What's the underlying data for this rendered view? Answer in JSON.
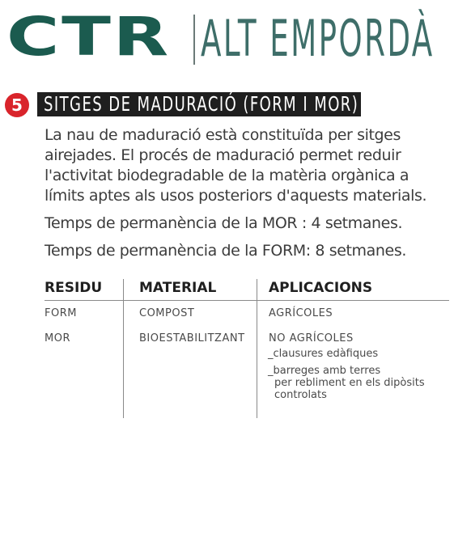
{
  "header": {
    "logo": "CTR",
    "subtitle": "ALT EMPORDÀ"
  },
  "section": {
    "number": "5",
    "title": "SITGES DE MADURACIÓ (FORM I MOR)"
  },
  "body": {
    "paragraph_1": "La nau de maduració està constituïda per sitges airejades. El procés de maduració permet reduir l'activitat biodegradable de la matèria orgànica a límits aptes als usos posteriors d'aquests materials.",
    "paragraph_2": "Temps de permanència de la MOR : 4 setmanes.",
    "paragraph_3": "Temps de permanència de la FORM: 8 setmanes."
  },
  "table": {
    "headers": [
      "RESIDU",
      "MATERIAL",
      "APLICACIONS"
    ],
    "rows": [
      {
        "residu": "FORM",
        "material": "COMPOST",
        "aplicacions": "AGRÍCOLES"
      },
      {
        "residu": "MOR",
        "material": "BIOESTABILITZANT",
        "aplicacions": "NO AGRÍCOLES"
      }
    ],
    "sub_items": [
      "_clausures edàfiques",
      "_barreges amb terres",
      "per rebliment en els dipòsits",
      "controlats"
    ]
  },
  "colors": {
    "brand_green": "#1b5b4f",
    "subtitle_teal": "#3e6e69",
    "badge_red": "#d9242b",
    "title_bar": "#1f1f1f"
  }
}
